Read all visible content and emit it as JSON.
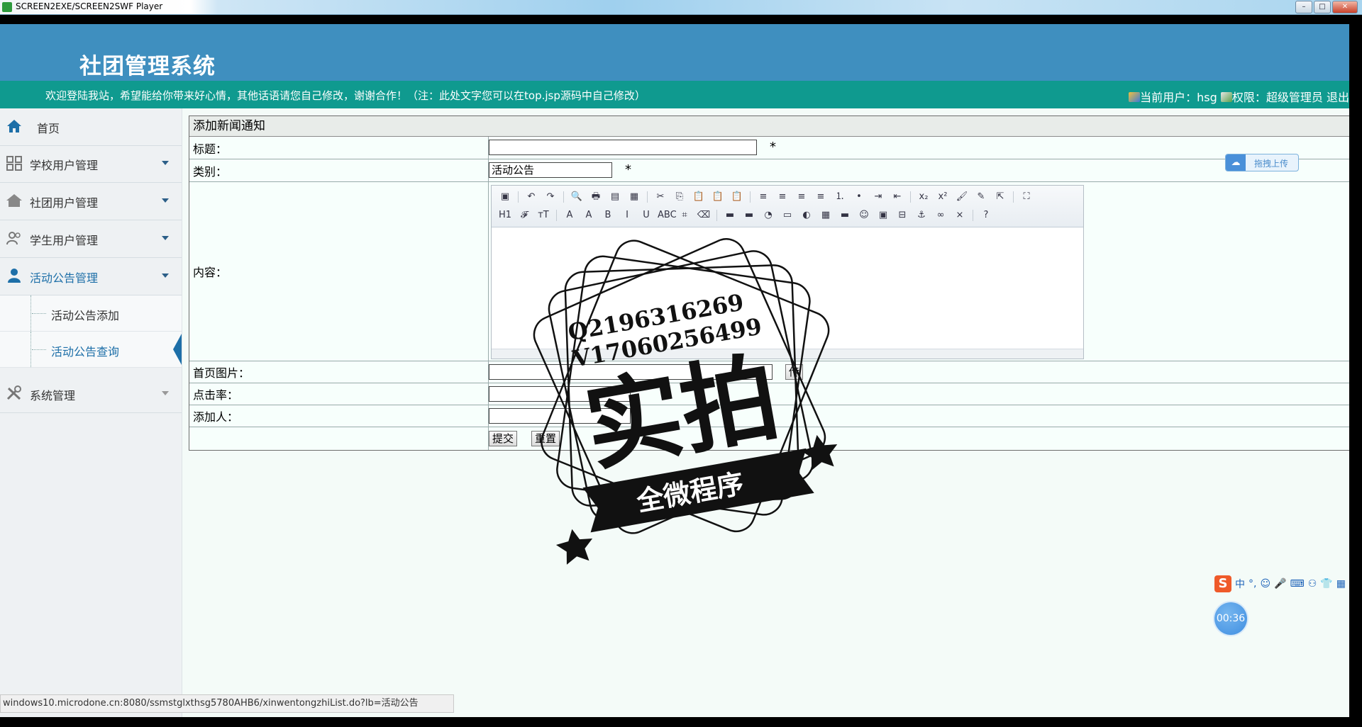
{
  "window": {
    "title": "SCREEN2EXE/SCREEN2SWF Player",
    "buttons": [
      "–",
      "□",
      "✕"
    ]
  },
  "header": {
    "system_title": "社团管理系统"
  },
  "welcome_bar": {
    "message": "欢迎登陆我站，希望能给你带来好心情，其他话语请您自己修改，谢谢合作！（注：此处文字您可以在top.jsp源码中自己修改）",
    "current_user": "当前用户：hsg",
    "permission": "权限：超级管理员",
    "logout": "退出"
  },
  "sidebar": {
    "home": "首页",
    "items": [
      {
        "label": "学校用户管理"
      },
      {
        "label": "社团用户管理"
      },
      {
        "label": "学生用户管理"
      },
      {
        "label": "活动公告管理"
      },
      {
        "label": "系统管理"
      }
    ],
    "subitems": [
      {
        "label": "活动公告添加"
      },
      {
        "label": "活动公告查询"
      }
    ]
  },
  "form": {
    "heading": "添加新闻通知",
    "fields": {
      "title_label": "标题：",
      "category_label": "类别：",
      "category_value": "活动公告",
      "content_label": "内容：",
      "image_label": "首页图片：",
      "image_button": "传",
      "clicks_label": "点击率：",
      "adder_label": "添加人："
    },
    "required_mark": "*",
    "submit": "提交",
    "reset": "重置"
  },
  "editor_toolbar": {
    "row1": [
      "▣",
      "↶",
      "↷",
      "🔍",
      "🖶",
      "▤",
      "▦",
      "✂",
      "⎘",
      "📋",
      "📋",
      "📋",
      "≡",
      "≡",
      "≡",
      "≡",
      "⒈",
      "•",
      "⇥",
      "⇤",
      "x₂",
      "x²",
      "🖌",
      "✎",
      "⇱",
      "⛶"
    ],
    "row2": [
      "H1",
      "𝓕",
      "тT",
      "A",
      "A",
      "B",
      "I",
      "U",
      "ABC",
      "⌗",
      "⌫",
      "▬",
      "▬",
      "◔",
      "▭",
      "◐",
      "▦",
      "▬",
      "☺",
      "▣",
      "⊟",
      "⚓",
      "∞",
      "⨯",
      "?"
    ]
  },
  "upload_widget": {
    "label": "拖拽上传"
  },
  "watermark": {
    "line1": "Q2196316269",
    "line2": "V17060256499",
    "big_text": "实拍",
    "ribbon_text": "全微程序"
  },
  "ime": {
    "logo": "S",
    "items": [
      "中",
      "°,",
      "☺",
      "🎤",
      "⌨",
      "⚇",
      "👕",
      "▦"
    ]
  },
  "timer": {
    "value": "00:36"
  },
  "statusbar": {
    "url": "windows10.microdone.cn:8080/ssmstglxthsg5780AHB6/xinwentongzhiList.do?lb=活动公告"
  },
  "colors": {
    "header_blue": "#3f8fbf",
    "welcome_teal": "#0f9a8f",
    "accent": "#1d6fa8"
  }
}
